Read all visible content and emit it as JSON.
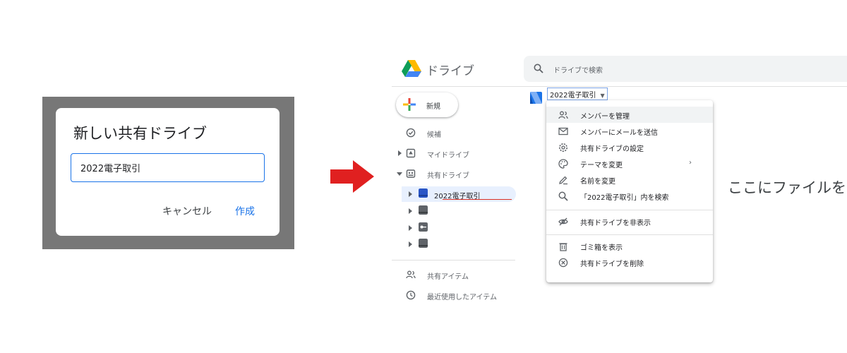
{
  "dialog": {
    "title": "新しい共有ドライブ",
    "input_value": "2022電子取引",
    "cancel_label": "キャンセル",
    "create_label": "作成"
  },
  "arrow_color": "#e02020",
  "drive": {
    "app_title": "ドライブ",
    "search_placeholder": "ドライブで検索",
    "new_label": "新規",
    "nav": [
      {
        "label": "候補",
        "icon": "check-circle-icon"
      },
      {
        "label": "マイドライブ",
        "icon": "my-drive-icon"
      },
      {
        "label": "共有ドライブ",
        "icon": "shared-drives-icon"
      }
    ],
    "shared_drives": [
      {
        "label": "2022電子取引",
        "icon": "folder-icon",
        "selected": true
      },
      {
        "label": "",
        "icon": "folder-icon"
      },
      {
        "label": "",
        "icon": "key-folder-icon"
      },
      {
        "label": "",
        "icon": "folder-icon"
      }
    ],
    "nav_bottom": [
      {
        "label": "共有アイテム",
        "icon": "people-icon"
      },
      {
        "label": "最近使用したアイテム",
        "icon": "clock-icon"
      }
    ],
    "breadcrumb": "2022電子取引",
    "empty_message": "ここにファイルを",
    "menu": {
      "items": [
        {
          "label": "メンバーを管理",
          "icon": "manage-members-icon"
        },
        {
          "label": "メンバーにメールを送信",
          "icon": "mail-icon"
        },
        {
          "label": "共有ドライブの設定",
          "icon": "settings-icon"
        },
        {
          "label": "テーマを変更",
          "icon": "palette-icon",
          "submenu": true
        },
        {
          "label": "名前を変更",
          "icon": "rename-icon"
        },
        {
          "label": "「2022電子取引」内を検索",
          "icon": "search-icon"
        },
        {
          "label": "共有ドライブを非表示",
          "icon": "hide-icon"
        },
        {
          "label": "ゴミ箱を表示",
          "icon": "trash-icon"
        },
        {
          "label": "共有ドライブを削除",
          "icon": "delete-icon"
        }
      ]
    }
  },
  "colors": {
    "accent": "#1a73e8",
    "selected_bg": "#e8f0fe",
    "highlight_red": "#d93025",
    "drive_blue": "#2a56c6"
  }
}
